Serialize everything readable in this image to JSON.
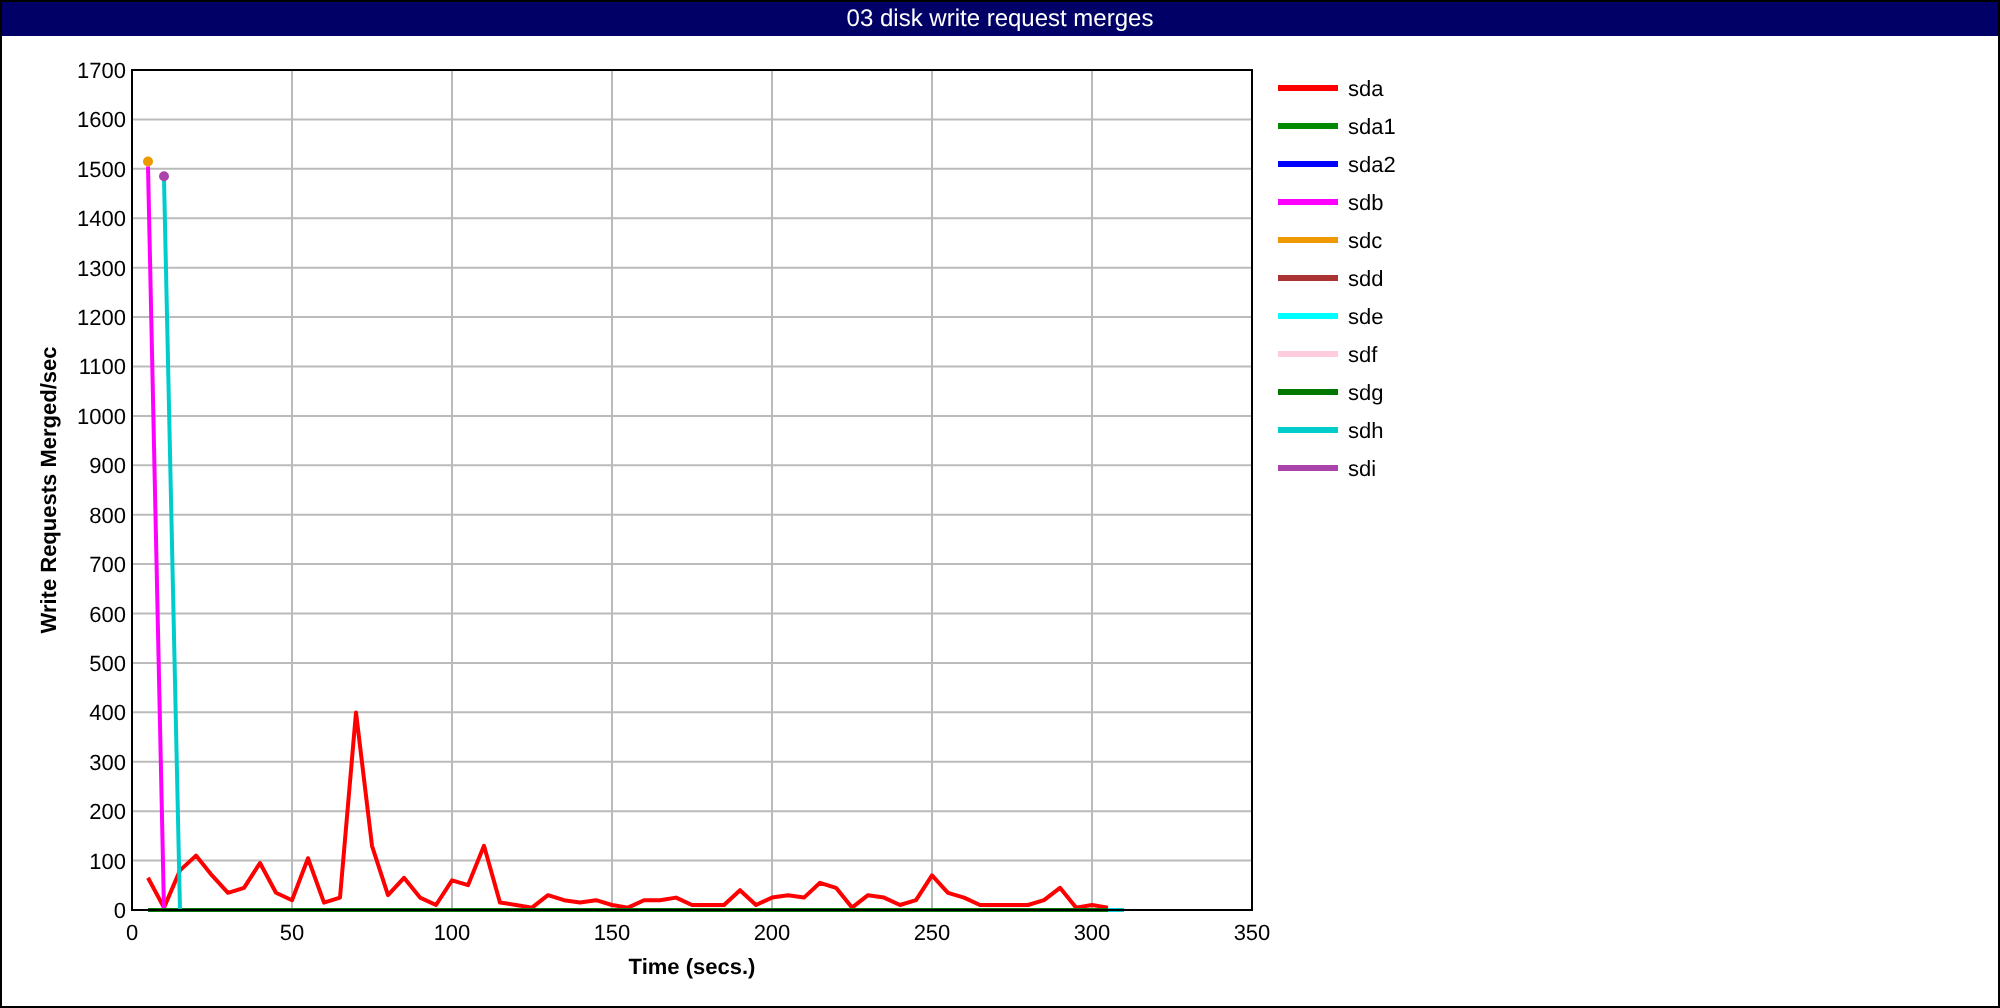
{
  "title": "03 disk write request merges",
  "chart_data": {
    "type": "line",
    "xlabel": "Time (secs.)",
    "ylabel": "Write Requests Merged/sec",
    "xlim": [
      0,
      350
    ],
    "ylim": [
      0,
      1700
    ],
    "grid": true,
    "legend": true,
    "xticks": [
      0,
      50,
      100,
      150,
      200,
      250,
      300,
      350
    ],
    "yticks": [
      0,
      100,
      200,
      300,
      400,
      500,
      600,
      700,
      800,
      900,
      1000,
      1100,
      1200,
      1300,
      1400,
      1500,
      1600,
      1700
    ],
    "x": [
      5,
      10,
      15,
      20,
      25,
      30,
      35,
      40,
      45,
      50,
      55,
      60,
      65,
      70,
      75,
      80,
      85,
      90,
      95,
      100,
      105,
      110,
      115,
      120,
      125,
      130,
      135,
      140,
      145,
      150,
      155,
      160,
      165,
      170,
      175,
      180,
      185,
      190,
      195,
      200,
      205,
      210,
      215,
      220,
      225,
      230,
      235,
      240,
      245,
      250,
      255,
      260,
      265,
      270,
      275,
      280,
      285,
      290,
      295,
      300,
      305,
      310
    ],
    "series": [
      {
        "name": "sda",
        "color": "#ff0000",
        "values": [
          65,
          5,
          80,
          110,
          70,
          35,
          45,
          95,
          35,
          20,
          105,
          15,
          25,
          400,
          130,
          30,
          65,
          25,
          10,
          60,
          50,
          130,
          15,
          10,
          5,
          30,
          20,
          15,
          20,
          10,
          5,
          20,
          20,
          25,
          10,
          10,
          10,
          40,
          10,
          25,
          30,
          25,
          55,
          45,
          5,
          30,
          25,
          10,
          20,
          70,
          35,
          25,
          10,
          10,
          10,
          10,
          20,
          45,
          5,
          10,
          5,
          null
        ]
      },
      {
        "name": "sda1",
        "color": "#008800",
        "values": [
          null,
          null,
          null,
          null,
          null,
          null,
          null,
          null,
          null,
          null,
          null,
          null,
          null,
          null,
          null,
          null,
          null,
          null,
          null,
          null,
          null,
          null,
          null,
          null,
          null,
          null,
          null,
          null,
          null,
          null,
          null,
          null,
          null,
          null,
          null,
          null,
          null,
          null,
          null,
          null,
          null,
          null,
          null,
          null,
          null,
          null,
          null,
          null,
          null,
          null,
          null,
          null,
          null,
          null,
          null,
          null,
          null,
          null,
          null,
          null,
          null,
          null
        ]
      },
      {
        "name": "sda2",
        "color": "#0000ff",
        "values": [
          null,
          null,
          null,
          null,
          null,
          null,
          null,
          null,
          null,
          null,
          null,
          null,
          null,
          null,
          null,
          null,
          null,
          null,
          null,
          null,
          null,
          null,
          null,
          null,
          null,
          null,
          null,
          null,
          null,
          null,
          null,
          null,
          null,
          null,
          null,
          null,
          null,
          null,
          null,
          null,
          null,
          null,
          null,
          null,
          null,
          null,
          null,
          null,
          null,
          null,
          null,
          null,
          null,
          null,
          null,
          null,
          null,
          null,
          null,
          null,
          null,
          null
        ]
      },
      {
        "name": "sdb",
        "color": "#ff00ff",
        "values": [
          1505,
          0,
          null,
          null,
          null,
          null,
          null,
          null,
          null,
          null,
          null,
          null,
          null,
          null,
          null,
          null,
          null,
          null,
          null,
          null,
          null,
          null,
          null,
          null,
          null,
          null,
          null,
          null,
          null,
          null,
          null,
          null,
          null,
          null,
          null,
          null,
          null,
          null,
          null,
          null,
          null,
          null,
          null,
          null,
          null,
          null,
          null,
          null,
          null,
          null,
          null,
          null,
          null,
          null,
          null,
          null,
          null,
          null,
          null,
          null,
          null,
          null
        ]
      },
      {
        "name": "sdc",
        "color": "#ee9900",
        "marker": true,
        "values": [
          1515,
          null,
          null,
          null,
          null,
          null,
          null,
          null,
          null,
          null,
          null,
          null,
          null,
          null,
          null,
          null,
          null,
          null,
          null,
          null,
          null,
          null,
          null,
          null,
          null,
          null,
          null,
          null,
          null,
          null,
          null,
          null,
          null,
          null,
          null,
          null,
          null,
          null,
          null,
          null,
          null,
          null,
          null,
          null,
          null,
          null,
          null,
          null,
          null,
          null,
          null,
          null,
          null,
          null,
          null,
          null,
          null,
          null,
          null,
          null,
          null,
          null
        ]
      },
      {
        "name": "sdd",
        "color": "#aa3333",
        "values": [
          null,
          null,
          null,
          null,
          null,
          null,
          null,
          null,
          null,
          null,
          null,
          null,
          null,
          null,
          null,
          null,
          null,
          null,
          null,
          null,
          null,
          null,
          null,
          null,
          null,
          null,
          null,
          null,
          null,
          null,
          null,
          null,
          null,
          null,
          null,
          null,
          null,
          null,
          null,
          null,
          null,
          null,
          null,
          null,
          null,
          null,
          null,
          null,
          null,
          null,
          null,
          null,
          null,
          null,
          null,
          null,
          null,
          null,
          null,
          null,
          null,
          null
        ]
      },
      {
        "name": "sde",
        "color": "#00ffff",
        "values": [
          null,
          null,
          null,
          null,
          null,
          null,
          null,
          null,
          null,
          null,
          null,
          null,
          null,
          null,
          null,
          null,
          null,
          null,
          null,
          null,
          null,
          null,
          null,
          null,
          null,
          null,
          null,
          null,
          null,
          null,
          null,
          null,
          null,
          null,
          null,
          null,
          null,
          null,
          null,
          null,
          null,
          null,
          null,
          null,
          null,
          null,
          null,
          null,
          null,
          null,
          null,
          null,
          null,
          null,
          null,
          null,
          null,
          null,
          null,
          null,
          null,
          null
        ]
      },
      {
        "name": "sdf",
        "color": "#ffccdd",
        "values": [
          null,
          null,
          null,
          null,
          null,
          null,
          null,
          null,
          null,
          null,
          null,
          null,
          null,
          null,
          null,
          null,
          null,
          null,
          null,
          null,
          null,
          null,
          null,
          null,
          null,
          null,
          null,
          null,
          null,
          null,
          null,
          null,
          null,
          null,
          null,
          null,
          null,
          null,
          null,
          null,
          null,
          null,
          null,
          null,
          null,
          null,
          null,
          null,
          null,
          null,
          null,
          null,
          null,
          null,
          null,
          null,
          null,
          null,
          null,
          null,
          null,
          null
        ]
      },
      {
        "name": "sdg",
        "color": "#007700",
        "values": [
          0,
          0,
          0,
          0,
          0,
          0,
          0,
          0,
          0,
          0,
          0,
          0,
          0,
          0,
          0,
          0,
          0,
          0,
          0,
          0,
          0,
          0,
          0,
          0,
          0,
          0,
          0,
          0,
          0,
          0,
          0,
          0,
          0,
          0,
          0,
          0,
          0,
          0,
          0,
          0,
          0,
          0,
          0,
          0,
          0,
          0,
          0,
          0,
          0,
          0,
          0,
          0,
          0,
          0,
          0,
          0,
          0,
          0,
          0,
          0,
          0,
          null
        ]
      },
      {
        "name": "sdh",
        "color": "#00cccc",
        "values": [
          null,
          1480,
          0,
          null,
          null,
          null,
          null,
          null,
          null,
          null,
          null,
          null,
          null,
          null,
          null,
          null,
          null,
          null,
          null,
          null,
          null,
          null,
          null,
          null,
          null,
          null,
          null,
          null,
          null,
          null,
          null,
          null,
          null,
          null,
          null,
          null,
          null,
          null,
          null,
          null,
          null,
          null,
          null,
          null,
          null,
          null,
          null,
          null,
          null,
          null,
          null,
          null,
          null,
          null,
          null,
          null,
          null,
          null,
          null,
          null,
          0,
          0
        ]
      },
      {
        "name": "sdi",
        "color": "#aa44aa",
        "marker": true,
        "values": [
          null,
          1485,
          null,
          null,
          null,
          null,
          null,
          null,
          null,
          null,
          null,
          null,
          null,
          null,
          null,
          null,
          null,
          null,
          null,
          null,
          null,
          null,
          null,
          null,
          null,
          null,
          null,
          null,
          null,
          null,
          null,
          null,
          null,
          null,
          null,
          null,
          null,
          null,
          null,
          null,
          null,
          null,
          null,
          null,
          null,
          null,
          null,
          null,
          null,
          null,
          null,
          null,
          null,
          null,
          null,
          null,
          null,
          null,
          null,
          null,
          null,
          null
        ]
      }
    ]
  }
}
